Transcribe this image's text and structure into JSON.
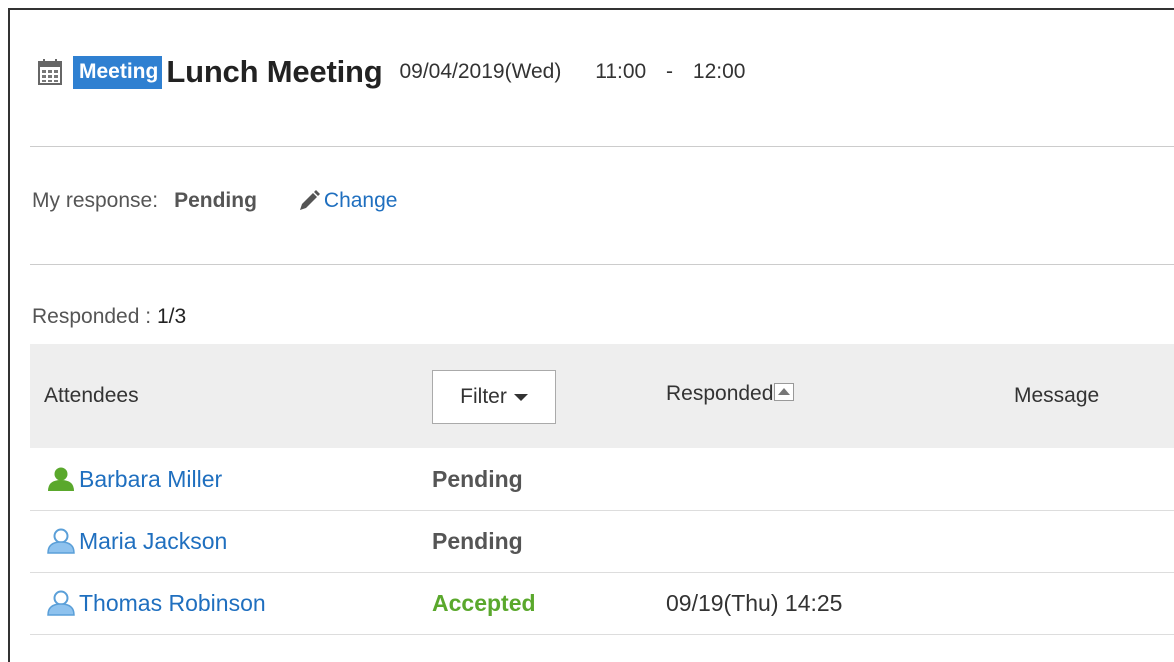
{
  "event": {
    "badge": "Meeting",
    "title": "Lunch Meeting",
    "date": "09/04/2019(Wed)",
    "start": "11:00",
    "dash": "-",
    "end": "12:00"
  },
  "my_response": {
    "label": "My response:",
    "value": "Pending",
    "change_label": "Change"
  },
  "responded_summary": {
    "label": "Responded :",
    "value": "1/3"
  },
  "table": {
    "headers": {
      "attendees": "Attendees",
      "filter": "Filter",
      "responded": "Responded",
      "message": "Message"
    },
    "rows": [
      {
        "name": "Barbara Miller",
        "status": "Pending",
        "responded": "",
        "message": "",
        "icon": "user-icon-green"
      },
      {
        "name": "Maria Jackson",
        "status": "Pending",
        "responded": "",
        "message": "",
        "icon": "user-icon-blue"
      },
      {
        "name": "Thomas Robinson",
        "status": "Accepted",
        "responded": "09/19(Thu) 14:25",
        "message": "",
        "icon": "user-icon-blue"
      }
    ]
  },
  "colors": {
    "badge_bg": "#2f80d1",
    "link": "#1f6fbf",
    "accepted": "#5aa82c",
    "header_bg": "#eeeeee"
  }
}
